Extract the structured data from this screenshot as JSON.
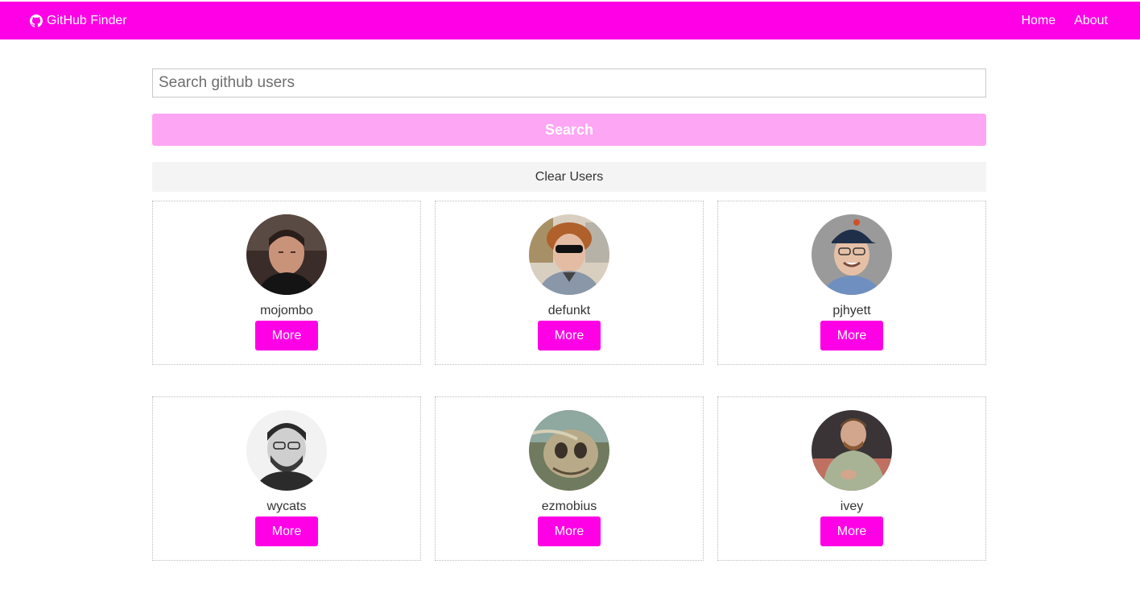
{
  "navbar": {
    "brand_icon": "github-icon",
    "title": "GitHub Finder",
    "links": [
      {
        "label": "Home"
      },
      {
        "label": "About"
      }
    ]
  },
  "search": {
    "placeholder": "Search github users",
    "button_label": "Search"
  },
  "clear_label": "Clear Users",
  "colors": {
    "accent": "#ff00e6",
    "accent_light": "#fda6f4",
    "clear_bg": "#f4f4f4"
  },
  "users": [
    {
      "login": "mojombo",
      "more_label": "More"
    },
    {
      "login": "defunkt",
      "more_label": "More"
    },
    {
      "login": "pjhyett",
      "more_label": "More"
    },
    {
      "login": "wycats",
      "more_label": "More"
    },
    {
      "login": "ezmobius",
      "more_label": "More"
    },
    {
      "login": "ivey",
      "more_label": "More"
    }
  ]
}
